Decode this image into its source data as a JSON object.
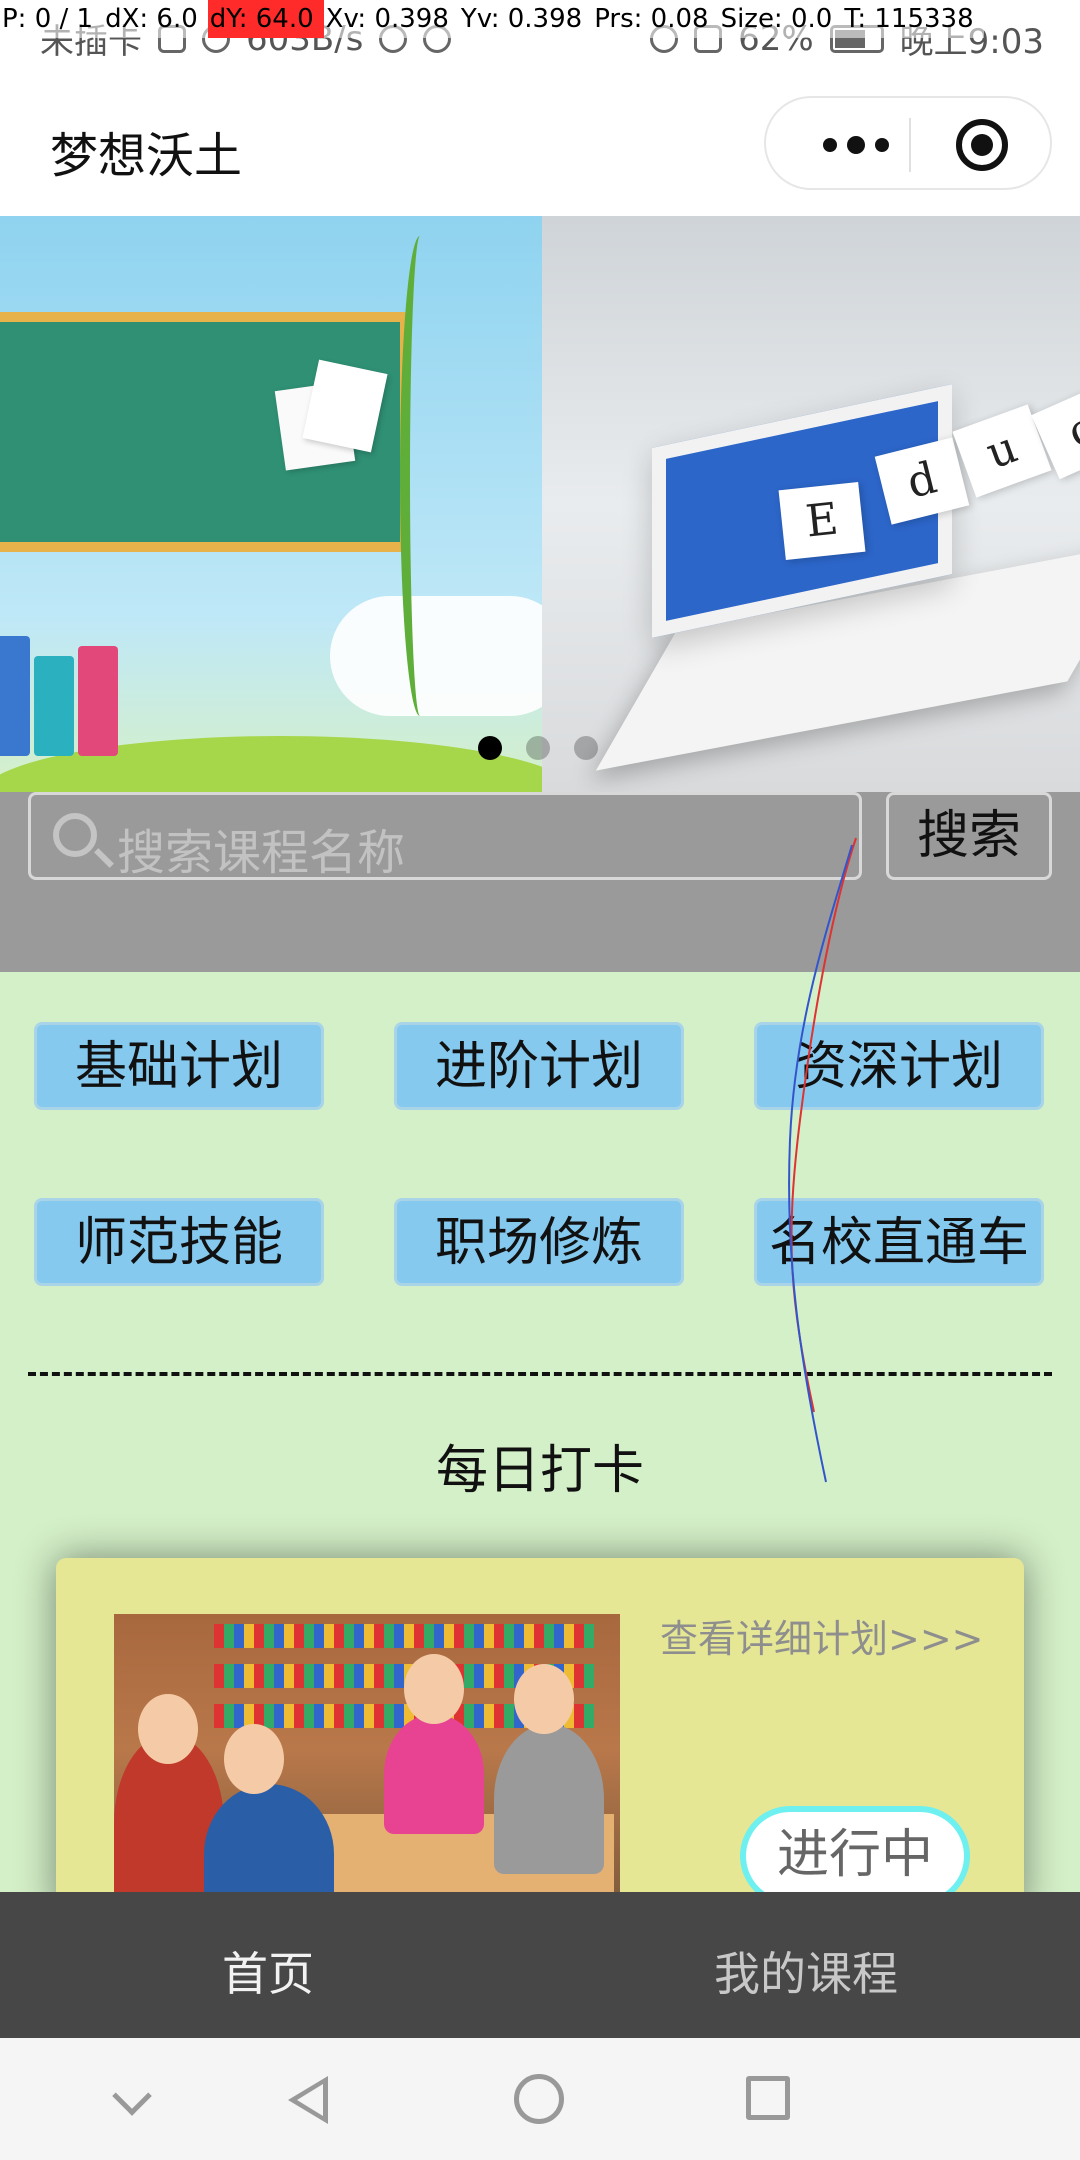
{
  "status_bar": {
    "carrier": "未插卡",
    "speed": "603B/s",
    "battery": "62%",
    "time": "晚上9:03"
  },
  "debug_overlay": {
    "p": "P: 0 / 1",
    "dx": "dX: 6.0",
    "dy": "dY: 64.0",
    "xv": "Xv: 0.398",
    "yv": "Yv: 0.398",
    "prs": "Prs: 0.08",
    "size": "Size: 0.0",
    "t": "T: 115338"
  },
  "header": {
    "title": "梦想沃土",
    "more_icon": "more-dots-icon",
    "close_icon": "target-close-icon"
  },
  "banner": {
    "slide2_letters": [
      "E",
      "d",
      "u",
      "c"
    ],
    "active_index": 0,
    "dot_count": 3
  },
  "search": {
    "placeholder": "搜索课程名称",
    "button_label": "搜索",
    "icon": "search-icon"
  },
  "categories": [
    "基础计划",
    "进阶计划",
    "资深计划",
    "师范技能",
    "职场修炼",
    "名校直通车"
  ],
  "divider_text": "--------------------------------------------------",
  "checkin": {
    "title": "每日打卡",
    "card": {
      "link_text": "查看详细计划>>>",
      "status": "进行中"
    }
  },
  "tabs": [
    {
      "label": "首页",
      "active": true
    },
    {
      "label": "我的课程",
      "active": false
    }
  ],
  "colors": {
    "content_bg": "#d4f0c8",
    "category_btn": "#86c9ee",
    "card_bg": "#e6e795",
    "search_area": "#9a9a9a",
    "tabbar": "#474747",
    "status_pill_border": "#6df0ef"
  }
}
